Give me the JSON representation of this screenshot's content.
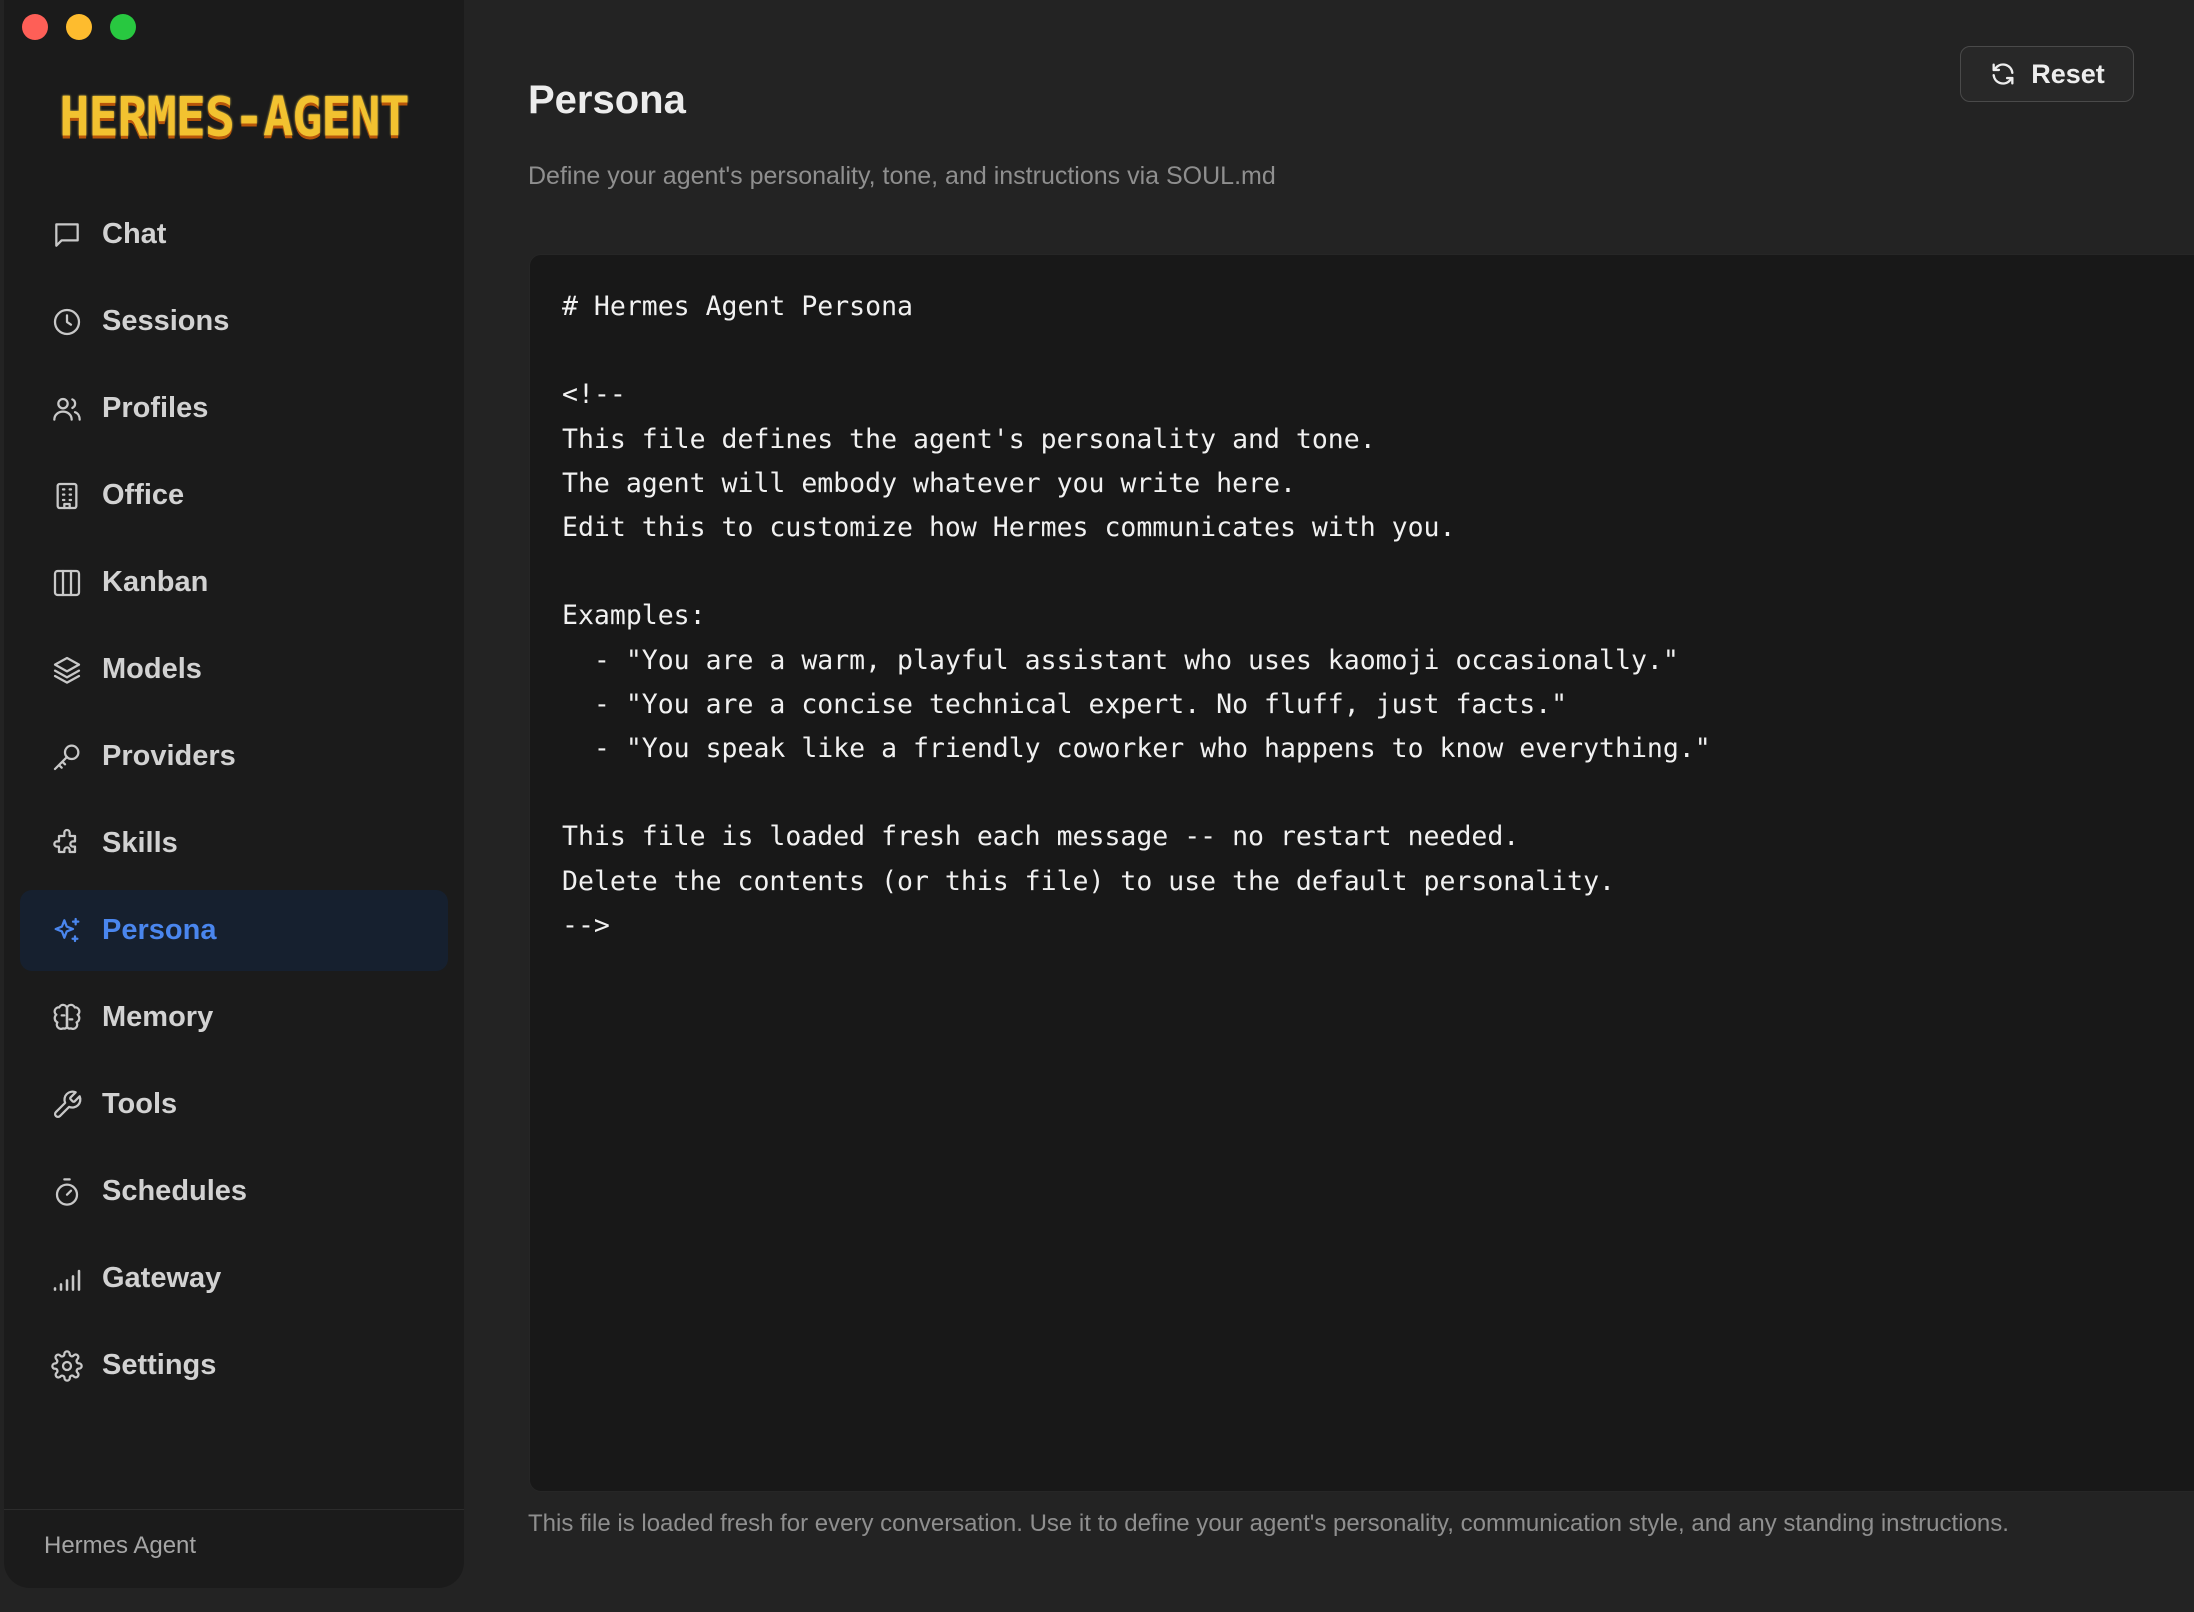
{
  "window": {
    "controls": [
      "close",
      "minimize",
      "maximize"
    ]
  },
  "sidebar": {
    "logo": "HERMES-AGENT",
    "items": [
      {
        "label": "Chat",
        "icon": "message-square-icon"
      },
      {
        "label": "Sessions",
        "icon": "clock-icon"
      },
      {
        "label": "Profiles",
        "icon": "users-icon"
      },
      {
        "label": "Office",
        "icon": "building-icon"
      },
      {
        "label": "Kanban",
        "icon": "columns-icon"
      },
      {
        "label": "Models",
        "icon": "layers-icon"
      },
      {
        "label": "Providers",
        "icon": "key-icon"
      },
      {
        "label": "Skills",
        "icon": "puzzle-icon"
      },
      {
        "label": "Persona",
        "icon": "sparkles-icon",
        "active": true
      },
      {
        "label": "Memory",
        "icon": "brain-icon"
      },
      {
        "label": "Tools",
        "icon": "wrench-icon"
      },
      {
        "label": "Schedules",
        "icon": "timer-icon"
      },
      {
        "label": "Gateway",
        "icon": "signal-bars-icon"
      },
      {
        "label": "Settings",
        "icon": "gear-icon"
      }
    ],
    "footer": "Hermes Agent"
  },
  "main": {
    "title": "Persona",
    "subtitle": "Define your agent's personality, tone, and instructions via SOUL.md",
    "reset_label": "Reset",
    "editor_content": "# Hermes Agent Persona\n\n<!--\nThis file defines the agent's personality and tone.\nThe agent will embody whatever you write here.\nEdit this to customize how Hermes communicates with you.\n\nExamples:\n  - \"You are a warm, playful assistant who uses kaomoji occasionally.\"\n  - \"You are a concise technical expert. No fluff, just facts.\"\n  - \"You speak like a friendly coworker who happens to know everything.\"\n\nThis file is loaded fresh each message -- no restart needed.\nDelete the contents (or this file) to use the default personality.\n-->",
    "footer_note": "This file is loaded fresh for every conversation. Use it to define your agent's personality, communication style, and any standing instructions."
  },
  "colors": {
    "accent": "#4a86ee",
    "active_bg": "#16202f",
    "logo": "#f2c230"
  }
}
